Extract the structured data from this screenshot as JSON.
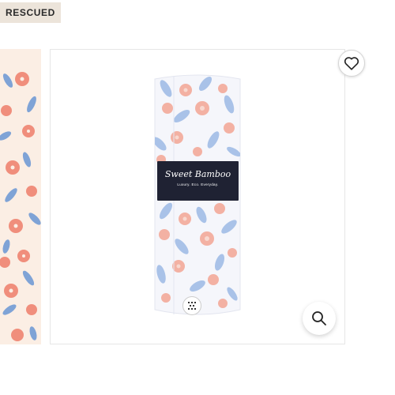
{
  "badge": {
    "label": "RESCUED"
  },
  "product_image": {
    "brand_label": "Sweet Bamboo",
    "tagline": "Luxury. Eco. Everyday."
  },
  "icons": {
    "wishlist": "heart-icon",
    "zoom": "magnifier-icon",
    "seal": "seal-icon"
  },
  "colors": {
    "badge_bg": "#ece4da",
    "label_band": "#1f2233",
    "flower_coral": "#f08e7c",
    "leaf_blue": "#7fa3d6"
  }
}
